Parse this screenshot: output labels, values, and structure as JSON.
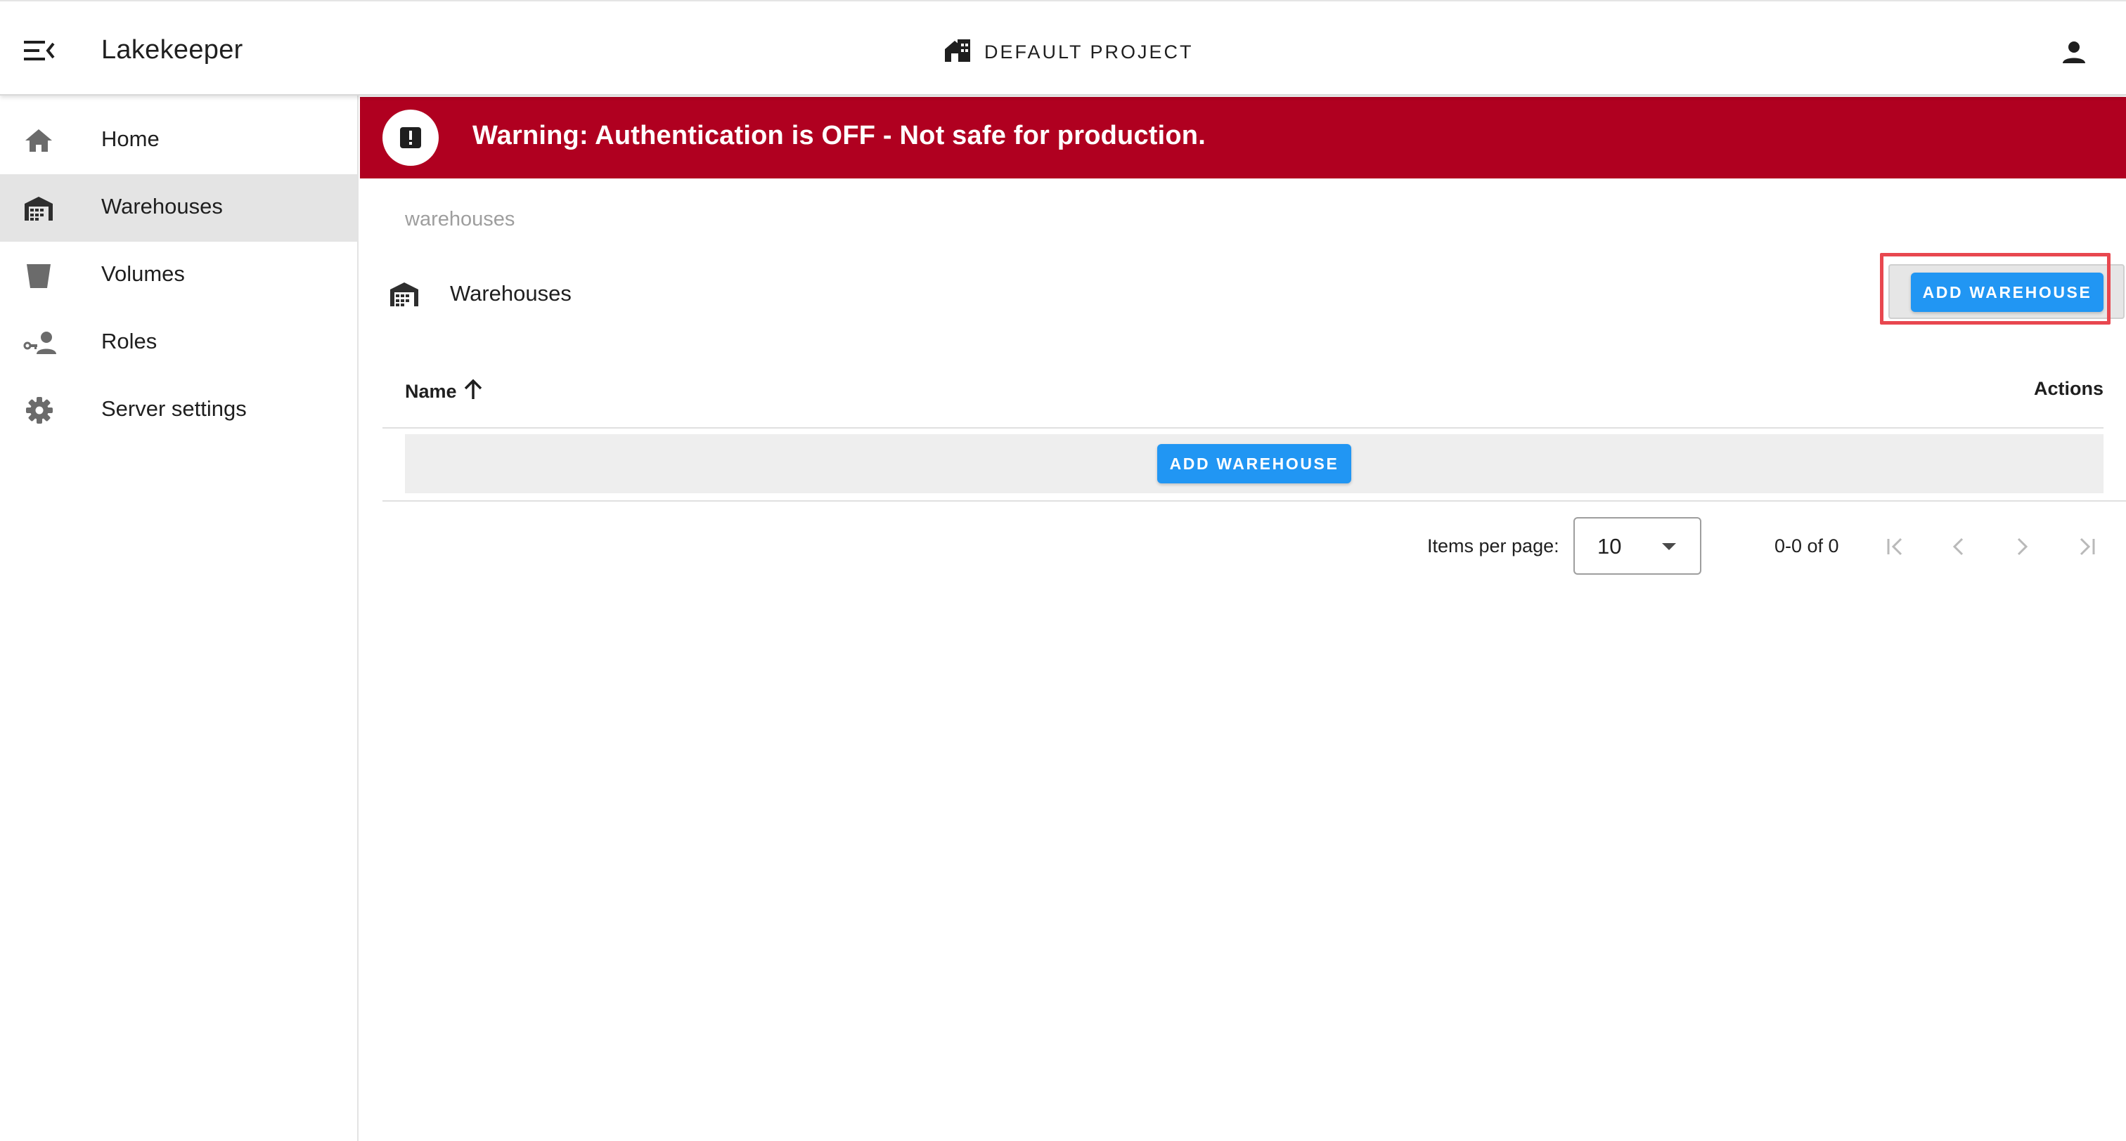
{
  "app": {
    "title": "Lakekeeper"
  },
  "header": {
    "project_label": "DEFAULT PROJECT"
  },
  "sidebar": {
    "items": [
      {
        "label": "Home",
        "icon": "home-icon"
      },
      {
        "label": "Warehouses",
        "icon": "warehouse-icon",
        "active": true
      },
      {
        "label": "Volumes",
        "icon": "bucket-icon"
      },
      {
        "label": "Roles",
        "icon": "account-key-icon"
      },
      {
        "label": "Server settings",
        "icon": "gear-icon"
      }
    ]
  },
  "banner": {
    "text": "Warning: Authentication is OFF - Not safe for production.",
    "color": "#b00020"
  },
  "breadcrumb": "warehouses",
  "section": {
    "title": "Warehouses",
    "add_button": "ADD WAREHOUSE"
  },
  "table": {
    "columns": [
      "Name",
      "Actions"
    ],
    "empty_button": "ADD WAREHOUSE"
  },
  "pagination": {
    "items_per_page_label": "Items per page:",
    "items_per_page": "10",
    "range": "0-0 of 0"
  },
  "colors": {
    "primary": "#2196f3",
    "highlight": "#e8474f",
    "active_nav": "#e4e4e4"
  }
}
